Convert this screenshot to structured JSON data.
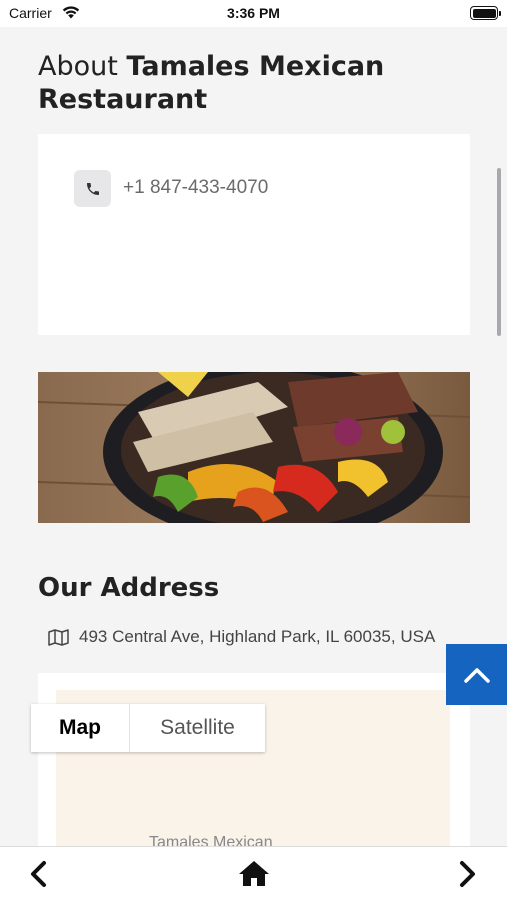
{
  "status_bar": {
    "carrier": "Carrier",
    "time": "3:36 PM",
    "wifi_icon": "wifi-icon",
    "battery_icon": "battery-icon"
  },
  "about": {
    "prefix": "About ",
    "restaurant_name": "Tamales Mexican Restaurant"
  },
  "contact": {
    "phone_icon": "phone-icon",
    "phone": "+1 847-433-4070"
  },
  "photo": {
    "subject": "fajita-food-photo"
  },
  "address_section": {
    "title": "Our Address",
    "map_icon": "map-icon",
    "address": "493 Central Ave, Highland Park, IL 60035, USA"
  },
  "map": {
    "tabs": [
      {
        "label": "Map",
        "selected": true
      },
      {
        "label": "Satellite",
        "selected": false
      }
    ],
    "place_label": "Tamales Mexican"
  },
  "floating_button": {
    "icon": "chevron-up-icon",
    "color": "#1565c0"
  },
  "bottom_nav": {
    "back_icon": "chevron-left-icon",
    "home_icon": "home-icon",
    "forward_icon": "chevron-right-icon"
  }
}
